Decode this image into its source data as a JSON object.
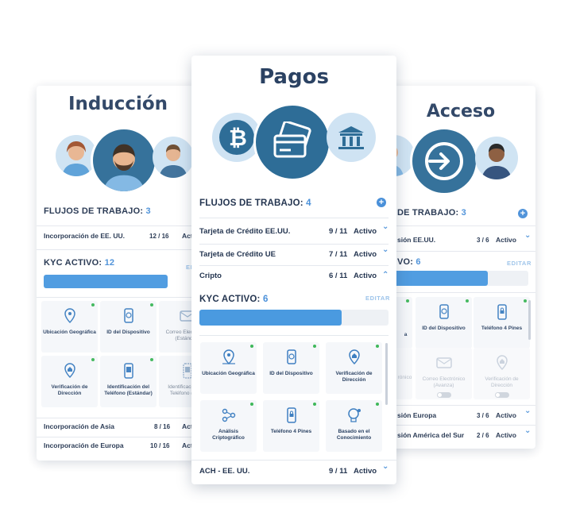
{
  "induccion": {
    "title": "Inducción",
    "flujos_label": "FLUJOS DE TRABAJO:",
    "flujos_count": "3",
    "rows_top": [
      {
        "name": "Incorporación de EE. UU.",
        "count": "12 / 16",
        "status": "Activ"
      }
    ],
    "kyc_label": "KYC ACTIVO:",
    "kyc_count": "12",
    "kyc_level": 0.72,
    "edit_label": "EDI",
    "tiles": [
      {
        "label": "Ubicación Geográfica",
        "icon": "location-pin-icon",
        "active": true
      },
      {
        "label": "ID del Dispositivo",
        "icon": "device-id-icon",
        "active": true
      },
      {
        "label": "Correo Electrónico (Estándar)",
        "icon": "email-icon",
        "active": true
      },
      {
        "label": "Verificación de Dirección",
        "icon": "address-pin-icon",
        "active": true
      },
      {
        "label": "Identificación del Teléfono (Estándar)",
        "icon": "phone-icon",
        "active": true
      },
      {
        "label": "Identificación del Teléfono (Avan",
        "icon": "phone-advanced-icon",
        "active": false
      }
    ],
    "rows_bottom": [
      {
        "name": "Incorporación de Asia",
        "count": "8 / 16",
        "status": "Activ"
      },
      {
        "name": "Incorporación de Europa",
        "count": "10 / 16",
        "status": "Activ"
      }
    ]
  },
  "pagos": {
    "title": "Pagos",
    "flujos_label": "FLUJOS DE TRABAJO:",
    "flujos_count": "4",
    "rows": [
      {
        "name": "Tarjeta de Crédito EE.UU.",
        "count": "9 / 11",
        "status": "Activo",
        "chev": "⌄"
      },
      {
        "name": "Tarjeta de Crédito UE",
        "count": "7 / 11",
        "status": "Activo",
        "chev": "⌄"
      },
      {
        "name": "Cripto",
        "count": "6 / 11",
        "status": "Activo",
        "chev": "⌃"
      }
    ],
    "kyc_label": "KYC ACTIVO:",
    "kyc_count": "6",
    "kyc_level": 0.75,
    "edit_label": "EDITAR",
    "tiles": [
      {
        "label": "Ubicación Geográfica",
        "icon": "location-pin-icon"
      },
      {
        "label": "ID del Dispositivo",
        "icon": "device-id-icon"
      },
      {
        "label": "Verificación de Dirección",
        "icon": "address-pin-icon"
      },
      {
        "label": "Análisis Criptográfico",
        "icon": "crypto-analysis-icon"
      },
      {
        "label": "Teléfono 4 Pines",
        "icon": "phone-lock-icon"
      },
      {
        "label": "Basado en el Conocimiento",
        "icon": "knowledge-icon"
      }
    ],
    "bottom_row": {
      "name": "ACH - EE. UU.",
      "count": "9 / 11",
      "status": "Activo",
      "chev": "⌄"
    }
  },
  "acceso": {
    "title": "Acceso",
    "flujos_label": "DE TRABAJO:",
    "flujos_count": "3",
    "rows_top": [
      {
        "name": "sión EE.UU.",
        "count": "3 / 6",
        "status": "Activo",
        "chev": "⌄"
      }
    ],
    "kyc_label": "VO:",
    "kyc_count": "6",
    "kyc_level": 0.66,
    "edit_label": "EDITAR",
    "tiles": [
      {
        "label": "a",
        "icon": "location-pin-icon",
        "active": true
      },
      {
        "label": "ID del Dispositivo",
        "icon": "device-id-icon",
        "active": true
      },
      {
        "label": "Teléfono 4 Pines",
        "icon": "phone-lock-icon",
        "active": true
      },
      {
        "label": "rónico",
        "icon": "email-icon",
        "active": false
      },
      {
        "label": "Correo Electrónico (Avanza)",
        "icon": "email-icon",
        "active": false
      },
      {
        "label": "Verificación de Dirección",
        "icon": "address-pin-icon",
        "active": false
      }
    ],
    "rows_bottom": [
      {
        "name": "sión Europa",
        "count": "3 / 6",
        "status": "Activo",
        "chev": "⌄"
      },
      {
        "name": "sión América del Sur",
        "count": "2 / 6",
        "status": "Activo",
        "chev": "⌄"
      }
    ]
  },
  "colors": {
    "accent": "#4a90d9",
    "navy": "#2b4263",
    "active_dot": "#3fb85a",
    "bar": "#4a9ae0"
  }
}
